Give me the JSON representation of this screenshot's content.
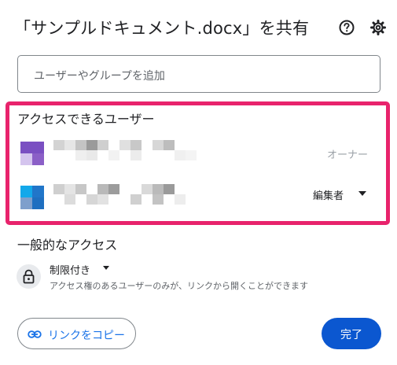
{
  "dialog": {
    "title": "「サンプルドキュメント.docx」を共有"
  },
  "header_icons": {
    "help": "help-circle-icon",
    "settings": "gear-icon"
  },
  "add_people": {
    "placeholder": "ユーザーやグループを追加"
  },
  "people_with_access": {
    "title": "アクセスできるユーザー",
    "users": [
      {
        "name": "",
        "role": "オーナー"
      },
      {
        "name": "",
        "role": "編集者"
      }
    ]
  },
  "general_access": {
    "title": "一般的なアクセス",
    "setting": "制限付き",
    "description": "アクセス権のあるユーザーのみが、リンクから開くことができます"
  },
  "actions": {
    "copy_link": "リンクをコピー",
    "done": "完了"
  },
  "colors": {
    "highlight": "#e8236c",
    "primary": "#0b57d0",
    "link": "#1a73e8"
  }
}
